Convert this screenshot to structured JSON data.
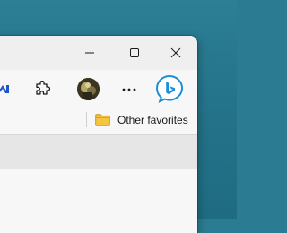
{
  "window": {
    "caption_buttons": {
      "minimize_icon": "minimize-icon",
      "maximize_icon": "maximize-icon",
      "close_icon": "close-icon"
    }
  },
  "toolbar": {
    "items": [
      {
        "icon": "extension-icon-partial"
      },
      {
        "icon": "puzzle-icon"
      },
      {
        "icon": "profile-avatar"
      },
      {
        "icon": "more-icon"
      },
      {
        "icon": "bing-chat-icon"
      }
    ]
  },
  "favorites_bar": {
    "other_favorites_label": "Other favorites",
    "folder_icon": "folder-icon",
    "folder_color": "#f5c542"
  },
  "colors": {
    "desktop": "#2b7c92",
    "bing_accent": "#1a8fd8"
  }
}
